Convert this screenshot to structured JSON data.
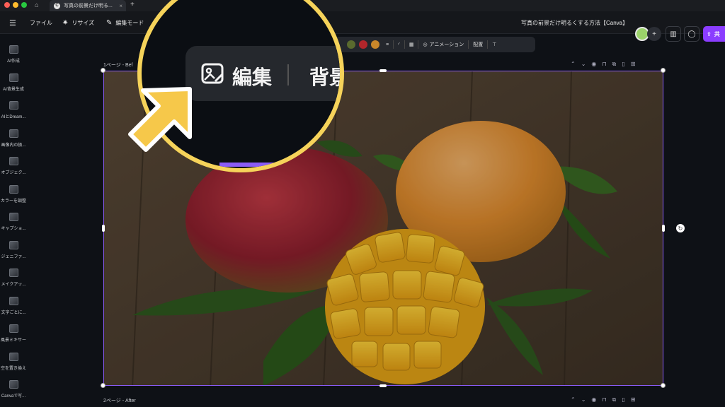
{
  "tabbar": {
    "tab_title": "写真の前景だけ明る...",
    "tab_favicon": "C",
    "close": "×",
    "new_tab": "+"
  },
  "toolbar": {
    "menu_icon": "☰",
    "file": "ファイル",
    "resize": "リサイズ",
    "edit_mode": "編集モード",
    "doc_title": "写真の前景だけ明るくする方法【Canva】",
    "add": "+",
    "share": "共"
  },
  "sidebar": {
    "items": [
      {
        "label": "AI作成"
      },
      {
        "label": "AI背景生成"
      },
      {
        "label": "AIとDream..."
      },
      {
        "label": "画像内の扱..."
      },
      {
        "label": "オブジェク..."
      },
      {
        "label": "カラーを調整"
      },
      {
        "label": "キャプショ..."
      },
      {
        "label": "ジェニファ..."
      },
      {
        "label": "メイクアッ..."
      },
      {
        "label": "文字ごとに..."
      },
      {
        "label": "風景ミキサー"
      },
      {
        "label": "空を置き換え"
      },
      {
        "label": "Canvaで写..."
      }
    ]
  },
  "canvas": {
    "page1_label": "1ページ - Bef",
    "page2_label": "2ページ - After"
  },
  "context_toolbar": {
    "animation": "アニメーション",
    "position": "配置",
    "swatch_colors": [
      "#5a6a2e",
      "#b3262b",
      "#c8862a"
    ]
  },
  "magnifier": {
    "edit_label": "編集",
    "background_label": "背景"
  },
  "colors": {
    "accent_purple": "#8b5cf6",
    "share_purple": "#8b3dff",
    "highlight_yellow": "#f6d35a"
  }
}
